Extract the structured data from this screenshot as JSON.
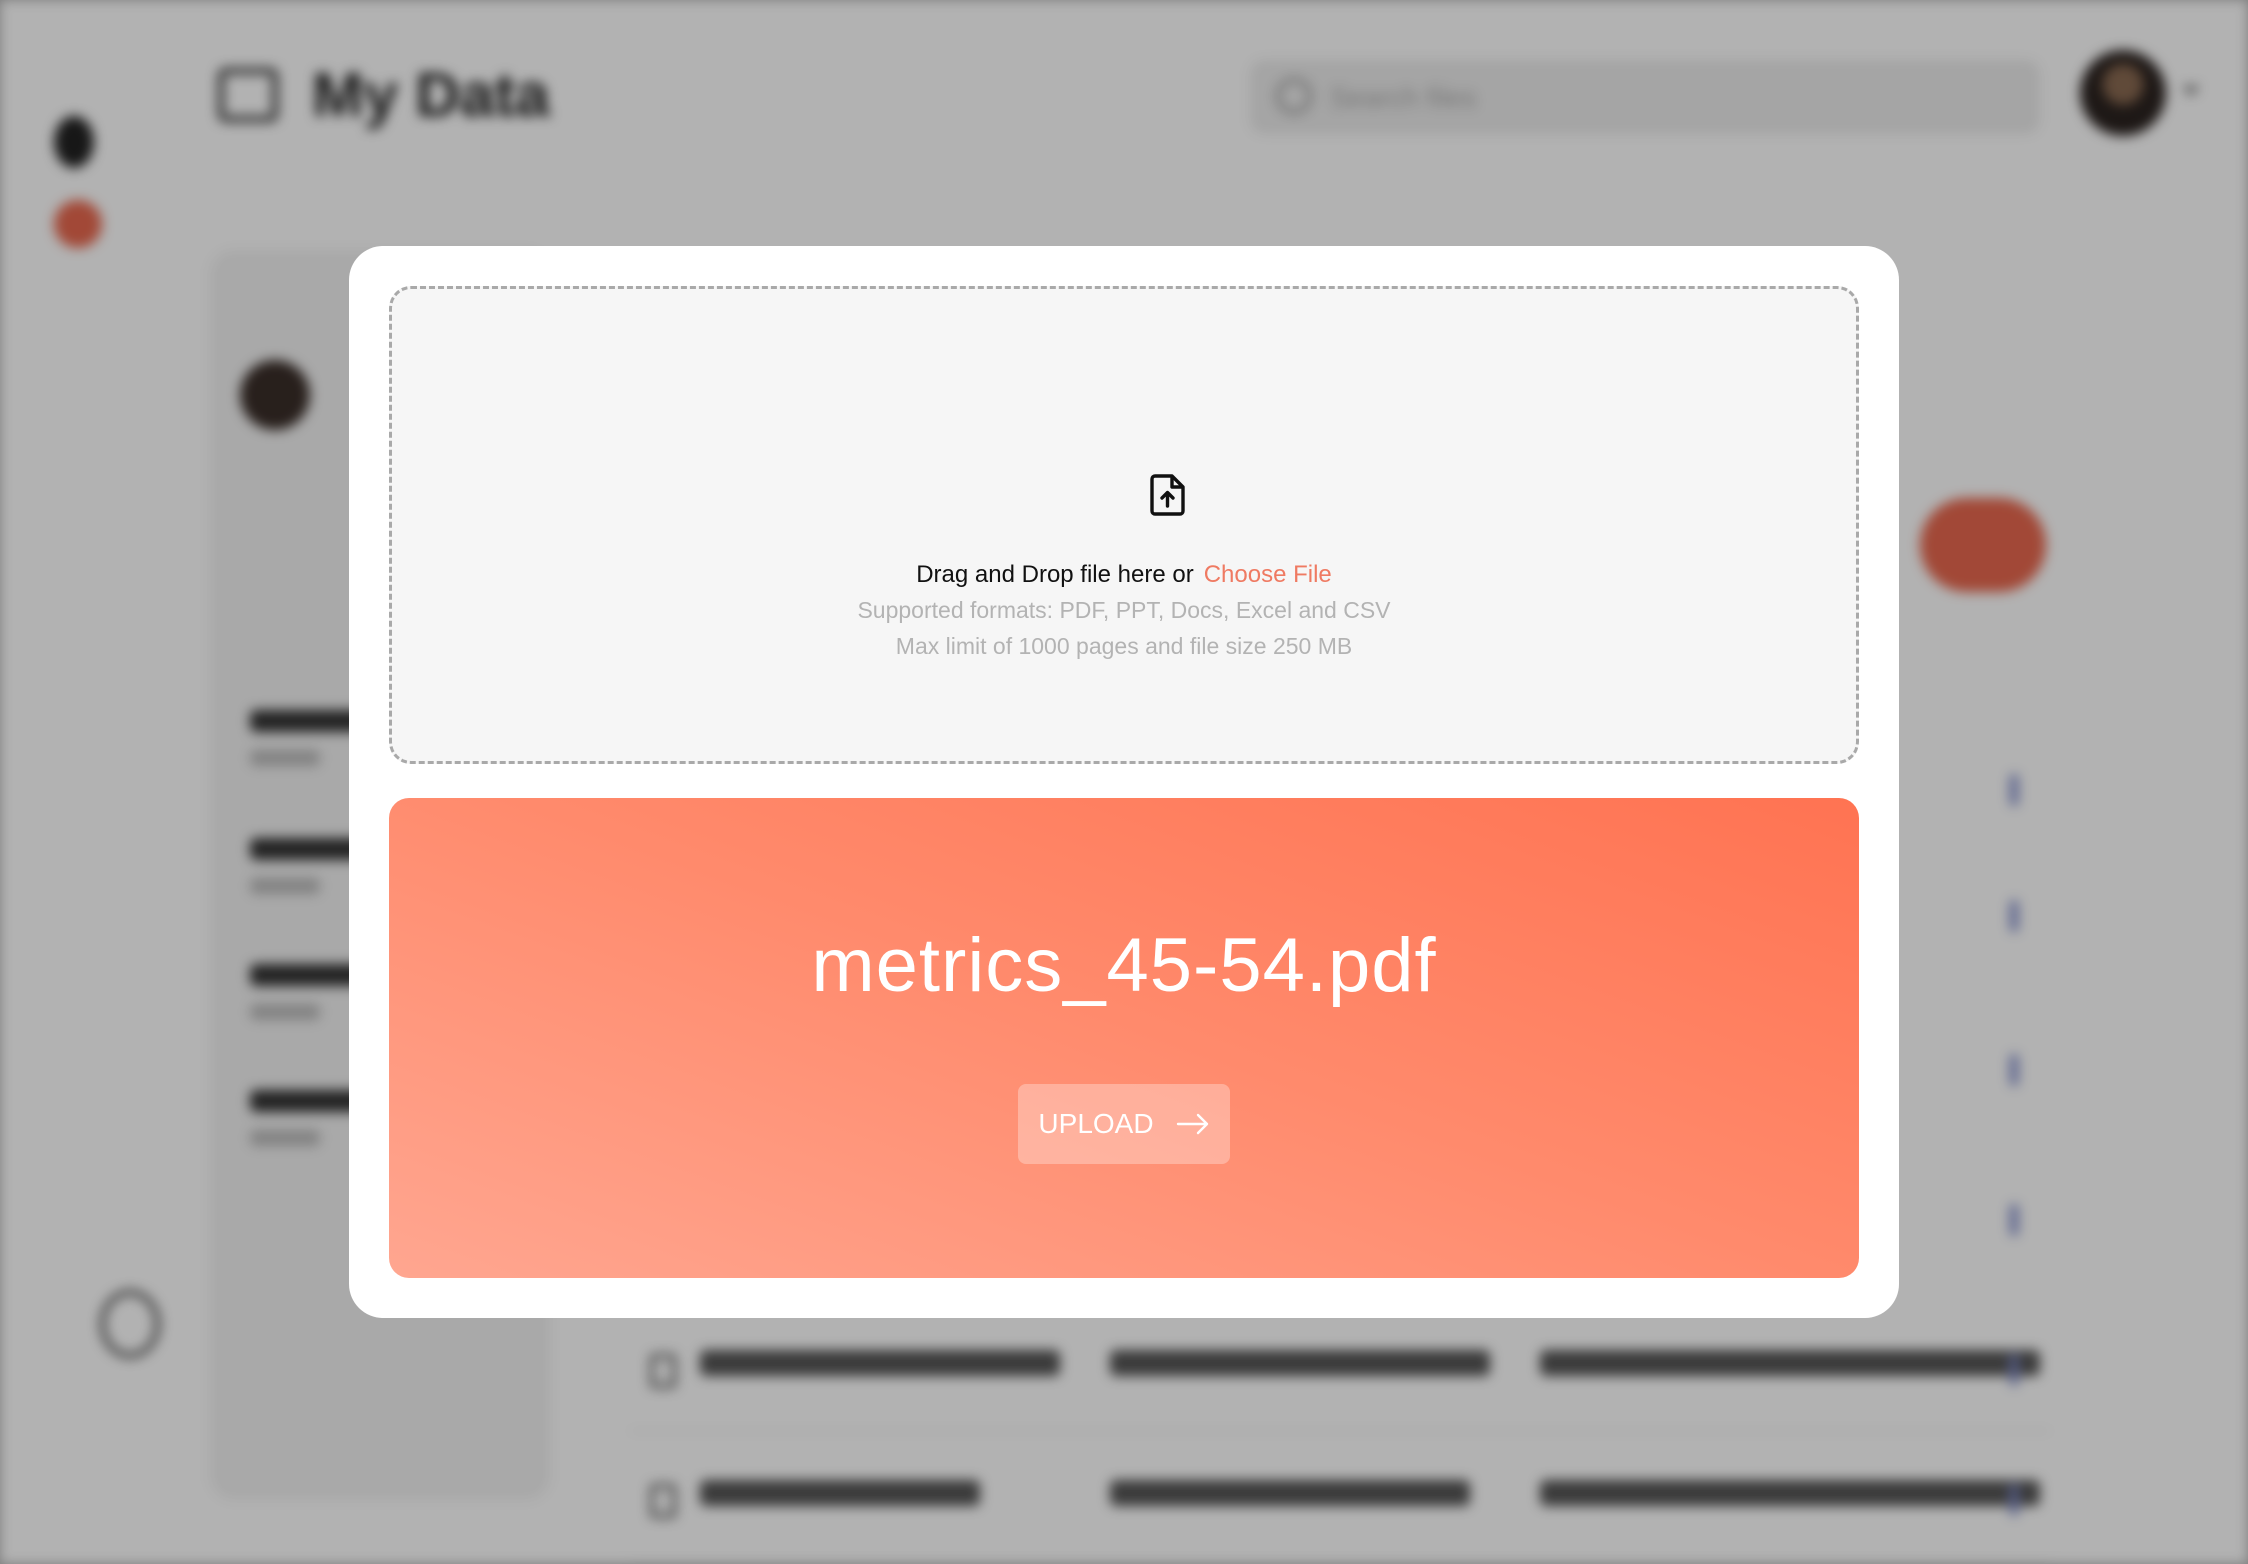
{
  "page": {
    "title": "My Data",
    "search_placeholder": "Search files"
  },
  "dropzone": {
    "prompt": "Drag and Drop file here or",
    "choose_file": "Choose File",
    "supported_formats": "Supported formats: PDF, PPT, Docs, Excel and CSV",
    "max_limit": "Max limit of 1000 pages and file size 250 MB",
    "icon": "file-upload-icon"
  },
  "selected_file": {
    "name": "metrics_45-54.pdf",
    "upload_label": "UPLOAD",
    "upload_icon": "arrow-right-icon"
  },
  "colors": {
    "accent": "#ef7a62",
    "card_gradient_start": "#ff7352",
    "card_gradient_end": "#ffa690"
  }
}
